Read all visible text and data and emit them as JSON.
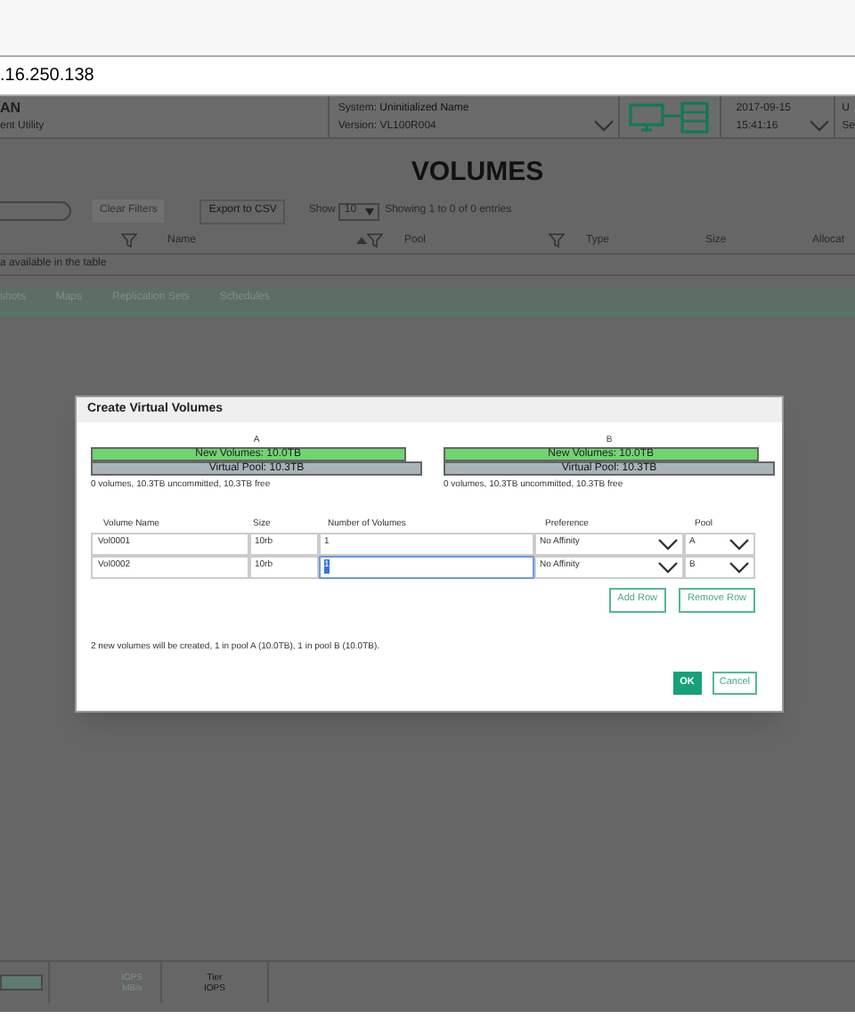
{
  "address_bar": {
    "url": ".16.250.138"
  },
  "header": {
    "app_name": "AN",
    "app_subtitle": "ent Utility",
    "system_label": "System:",
    "system_value": "Uninitialized Name",
    "version_label": "Version:",
    "version_value": "VL100R004",
    "date": "2017-09-15",
    "time": "15:41:16",
    "cut_line_1": "U",
    "cut_line_2": "Se"
  },
  "page_title": "VOLUMES",
  "toolbar": {
    "clear_filters": "Clear Filters",
    "export": "Export to CSV",
    "show_label": "Show",
    "show_value": "10",
    "entries": "Showing 1 to 0 of 0 entries"
  },
  "table": {
    "columns": [
      "Name",
      "Pool",
      "Type",
      "Size",
      "Allocat"
    ],
    "empty_message": "a available in the table"
  },
  "tabs": [
    {
      "label": "shots",
      "selected": false
    },
    {
      "label": "Maps",
      "selected": false
    },
    {
      "label": "Replication Sets",
      "selected": false
    },
    {
      "label": "Schedules",
      "selected": false
    }
  ],
  "bottom_bar": {
    "cell_1": [
      "IOPS",
      "MB/s"
    ],
    "cell_2": [
      "Tier",
      "IOPS"
    ]
  },
  "dialog": {
    "title": "Create Virtual Volumes",
    "pools": [
      {
        "name": "A",
        "new_volumes": "New Volumes: 10.0TB",
        "level": 0.95,
        "virtual_pool": "Virtual Pool: 10.3TB",
        "summary": "0 volumes, 10.3TB uncommitted, 10.3TB free"
      },
      {
        "name": "B",
        "new_volumes": "New Volumes: 10.0TB",
        "level": 0.95,
        "virtual_pool": "Virtual Pool: 10.3TB",
        "summary": "0 volumes, 10.3TB uncommitted, 10.3TB free"
      }
    ],
    "columns": [
      "Volume Name",
      "Size",
      "Number of Volumes",
      "Preference",
      "Pool"
    ],
    "rows": [
      {
        "name": "Vol0001",
        "size": "10rb",
        "count": "1",
        "focused": false,
        "preference": "No Affinity",
        "pool": "A"
      },
      {
        "name": "Vol0002",
        "size": "10rb",
        "count": "1",
        "focused": true,
        "preference": "No Affinity",
        "pool": "B"
      }
    ],
    "add_row": "Add Row",
    "remove_row": "Remove Row",
    "message": "2 new volumes will be created, 1 in pool A (10.0TB), 1 in pool B (10.0TB).",
    "ok": "OK",
    "cancel": "Cancel"
  }
}
